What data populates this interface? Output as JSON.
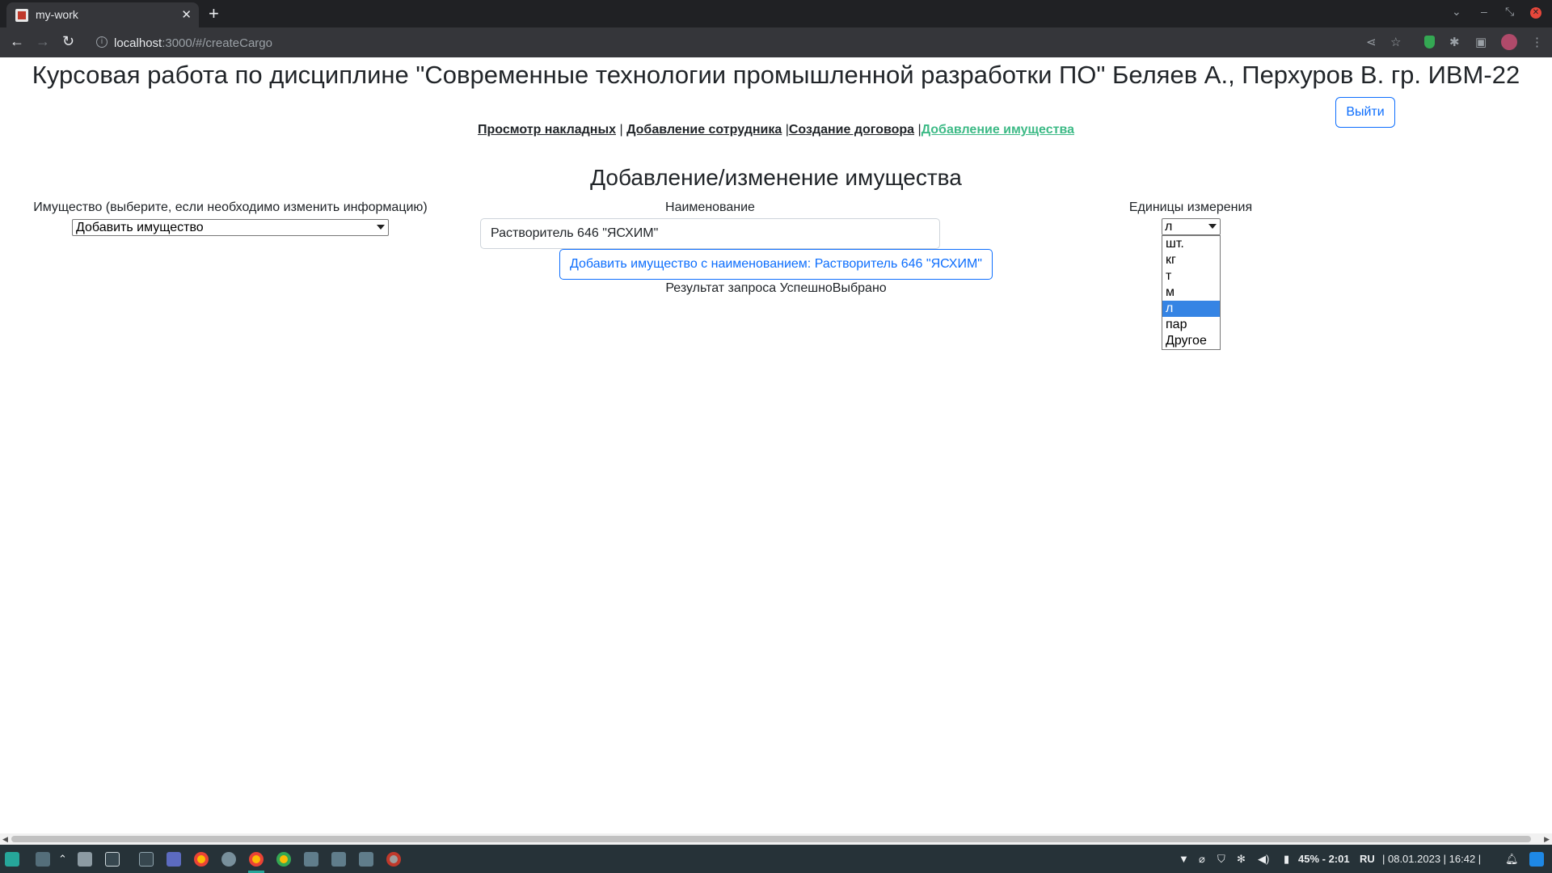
{
  "browser": {
    "tab_title": "my-work",
    "url_host": "localhost",
    "url_path": ":3000/#/createCargo"
  },
  "page": {
    "header": "Курсовая работа по дисциплине \"Современные технологии промышленной разработки ПО\" Беляев А., Перхуров В. гр. ИВМ-22",
    "logout_label": "Выйти",
    "nav": [
      {
        "label": "Просмотр накладных",
        "sep": " | "
      },
      {
        "label": "Добавление сотрудника",
        "sep": " |"
      },
      {
        "label": "Создание договора",
        "sep": " |"
      },
      {
        "label": "Добавление имущества",
        "sep": ""
      }
    ],
    "section_title": "Добавление/изменение имущества",
    "cargo_label": "Имущество (выберите, если необходимо изменить информацию)",
    "cargo_selected": "Добавить имущество",
    "name_label": "Наименование",
    "name_value": "Растворитель 646 \"ЯСХИМ\"",
    "add_button": "Добавить имущество с наименованием: Растворитель 646 \"ЯСХИМ\"",
    "result_text": "Результат запроса УспешноВыбрано",
    "units_label": "Единицы измерения",
    "units_selected": "л",
    "units_options": [
      "шт.",
      "кг",
      "т",
      "м",
      "л",
      "пар",
      "Другое"
    ]
  },
  "taskbar": {
    "battery": "45% - 2:01",
    "lang": "RU",
    "datetime": "| 08.01.2023 | 16:42 |"
  },
  "colors": {
    "active_link": "#3dba86",
    "primary": "#0d6efd",
    "selection": "#3584e4"
  }
}
